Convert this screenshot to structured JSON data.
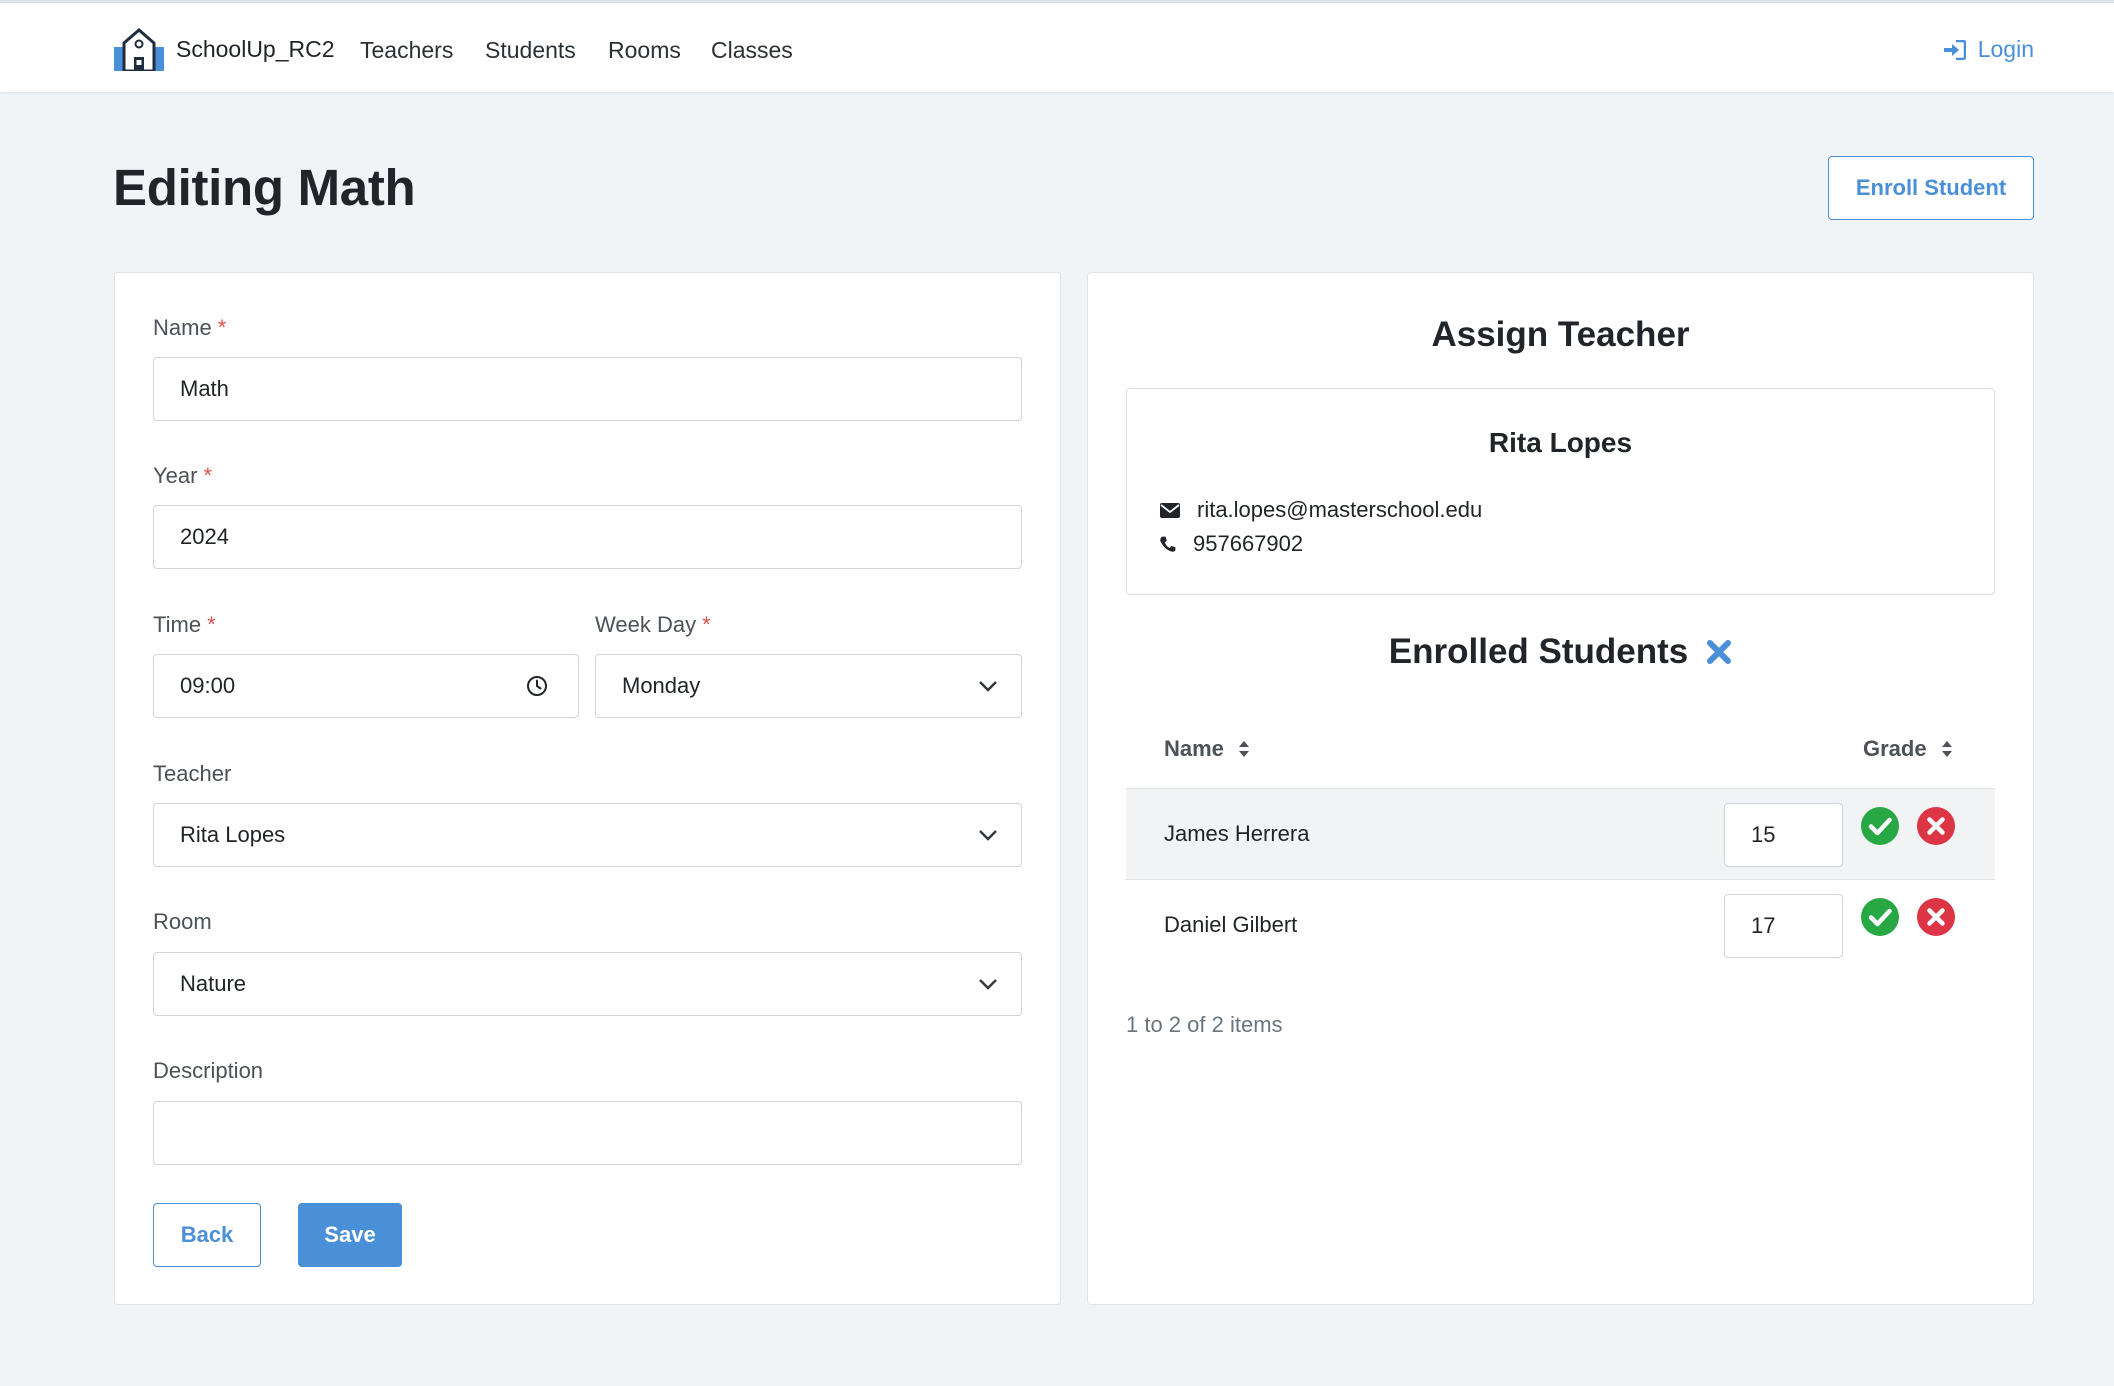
{
  "navbar": {
    "brand": "SchoolUp_RC2",
    "links": [
      "Teachers",
      "Students",
      "Rooms",
      "Classes"
    ],
    "login": "Login"
  },
  "header": {
    "title": "Editing Math",
    "enroll_button": "Enroll Student"
  },
  "form": {
    "name": {
      "label": "Name",
      "value": "Math",
      "required": "*"
    },
    "year": {
      "label": "Year",
      "value": "2024",
      "required": "*"
    },
    "time": {
      "label": "Time",
      "value": "09:00",
      "required": "*"
    },
    "week_day": {
      "label": "Week Day",
      "value": "Monday",
      "required": "*"
    },
    "teacher": {
      "label": "Teacher",
      "value": "Rita Lopes"
    },
    "room": {
      "label": "Room",
      "value": "Nature"
    },
    "description": {
      "label": "Description",
      "value": ""
    },
    "back_button": "Back",
    "save_button": "Save"
  },
  "assign_teacher": {
    "title": "Assign Teacher",
    "name": "Rita Lopes",
    "email": "rita.lopes@masterschool.edu",
    "phone": "957667902"
  },
  "enrolled": {
    "title": "Enrolled Students",
    "columns": {
      "name": "Name",
      "grade": "Grade"
    },
    "rows": [
      {
        "name": "James Herrera",
        "grade": "15"
      },
      {
        "name": "Daniel Gilbert",
        "grade": "17"
      }
    ],
    "pager": "1 to 2 of 2 items"
  },
  "colors": {
    "accent": "#4a90d9",
    "success": "#28a745",
    "danger": "#dc3545",
    "required": "#d9534f"
  }
}
